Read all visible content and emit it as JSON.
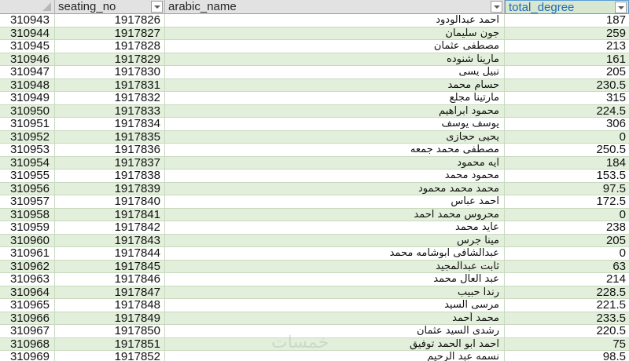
{
  "header": {
    "seating_no": "seating_no",
    "arabic_name": "arabic_name",
    "total_degree": "total_degree"
  },
  "watermark": "خمسات",
  "rows": [
    {
      "idx": "310943",
      "seat": "1917826",
      "name": "احمد عبدالودود",
      "total": "187"
    },
    {
      "idx": "310944",
      "seat": "1917827",
      "name": "جون سليمان",
      "total": "259"
    },
    {
      "idx": "310945",
      "seat": "1917828",
      "name": "مصطفى عثمان",
      "total": "213"
    },
    {
      "idx": "310946",
      "seat": "1917829",
      "name": "مارينا شنوده",
      "total": "161"
    },
    {
      "idx": "310947",
      "seat": "1917830",
      "name": "نبيل يسى",
      "total": "205"
    },
    {
      "idx": "310948",
      "seat": "1917831",
      "name": "حسام محمد",
      "total": "230.5"
    },
    {
      "idx": "310949",
      "seat": "1917832",
      "name": "مارتينا مجلع",
      "total": "315"
    },
    {
      "idx": "310950",
      "seat": "1917833",
      "name": "محمود ابراهيم",
      "total": "224.5"
    },
    {
      "idx": "310951",
      "seat": "1917834",
      "name": "يوسف يوسف",
      "total": "306"
    },
    {
      "idx": "310952",
      "seat": "1917835",
      "name": "يحيى حجازى",
      "total": "0"
    },
    {
      "idx": "310953",
      "seat": "1917836",
      "name": "مصطفى محمد جمعه",
      "total": "250.5"
    },
    {
      "idx": "310954",
      "seat": "1917837",
      "name": "آيه محمود",
      "total": "184"
    },
    {
      "idx": "310955",
      "seat": "1917838",
      "name": "محمود محمد",
      "total": "153.5"
    },
    {
      "idx": "310956",
      "seat": "1917839",
      "name": "محمد محمد محمود",
      "total": "97.5"
    },
    {
      "idx": "310957",
      "seat": "1917840",
      "name": "احمد عباس",
      "total": "172.5"
    },
    {
      "idx": "310958",
      "seat": "1917841",
      "name": "محروس محمد احمد",
      "total": "0"
    },
    {
      "idx": "310959",
      "seat": "1917842",
      "name": "عايد محمد",
      "total": "238"
    },
    {
      "idx": "310960",
      "seat": "1917843",
      "name": "مينا جرس",
      "total": "205"
    },
    {
      "idx": "310961",
      "seat": "1917844",
      "name": "عبدالشافى ابوشامه محمد",
      "total": "0"
    },
    {
      "idx": "310962",
      "seat": "1917845",
      "name": "ثابت عبدالمجيد",
      "total": "63"
    },
    {
      "idx": "310963",
      "seat": "1917846",
      "name": "عبد العال محمد",
      "total": "214"
    },
    {
      "idx": "310964",
      "seat": "1917847",
      "name": "رندا حبيب",
      "total": "228.5"
    },
    {
      "idx": "310965",
      "seat": "1917848",
      "name": "مرسى السيد",
      "total": "221.5"
    },
    {
      "idx": "310966",
      "seat": "1917849",
      "name": "محمد أحمد",
      "total": "233.5"
    },
    {
      "idx": "310967",
      "seat": "1917850",
      "name": "رشدى السيد عثمان",
      "total": "220.5"
    },
    {
      "idx": "310968",
      "seat": "1917851",
      "name": "احمد ابو الحمد توفيق",
      "total": "75"
    },
    {
      "idx": "310969",
      "seat": "1917852",
      "name": "نسمه عبد الرحيم",
      "total": "98.5"
    }
  ]
}
